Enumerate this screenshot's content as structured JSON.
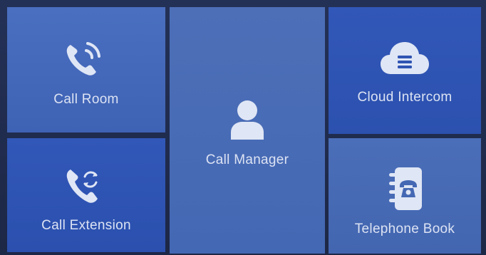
{
  "tiles": {
    "call_room": {
      "label": "Call Room",
      "icon": "phone-calling-icon"
    },
    "call_manager": {
      "label": "Call Manager",
      "icon": "person-icon"
    },
    "cloud_intercom": {
      "label": "Cloud Intercom",
      "icon": "cloud-icon"
    },
    "call_extension": {
      "label": "Call Extension",
      "icon": "phone-transfer-icon"
    },
    "telephone_book": {
      "label": "Telephone Book",
      "icon": "phone-book-icon"
    }
  },
  "colors": {
    "icon": "#dfe6f5",
    "tile_light": "#4a6fc0",
    "tile_dark": "#3157b8",
    "background": "#1f2a4c"
  }
}
